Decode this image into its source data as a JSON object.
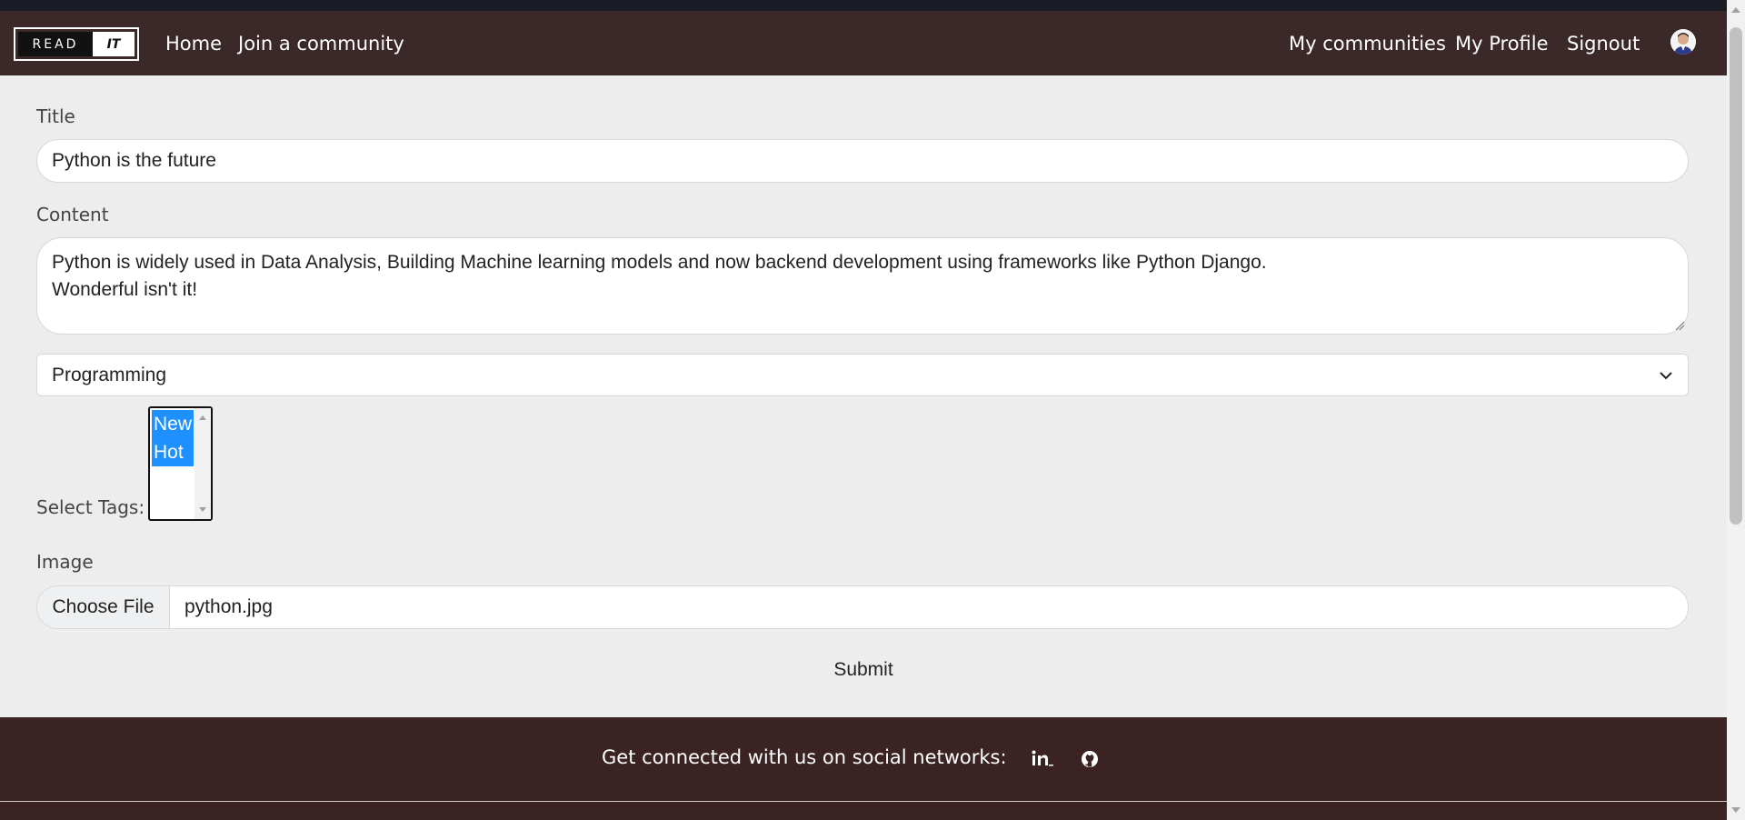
{
  "navbar": {
    "brand_left": "READ",
    "brand_right": "IT",
    "links_left": [
      "Home",
      "Join a community"
    ],
    "links_right": [
      "My communities",
      "My Profile",
      "Signout"
    ]
  },
  "form": {
    "title_label": "Title",
    "title_value": "Python is the future",
    "content_label": "Content",
    "content_line1": "Python is widely used in Data Analysis, Building Machine learning models and now backend development using frameworks like Python Django.",
    "content_line2": "Wonderful isn't it!",
    "community_selected": "Programming",
    "tags_label": "Select Tags:",
    "tags_options": [
      "New",
      "Hot"
    ],
    "image_label": "Image",
    "file_button": "Choose File",
    "file_name": "python.jpg",
    "submit_label": "Submit"
  },
  "footer": {
    "text": "Get connected with us on social networks:",
    "social_icons": [
      "linkedin-icon",
      "github-icon"
    ]
  },
  "colors": {
    "navbar_bg": "#3b2828",
    "footer_bg": "#3b2323",
    "page_bg": "#ededed",
    "tag_selected": "#1e90ff"
  }
}
